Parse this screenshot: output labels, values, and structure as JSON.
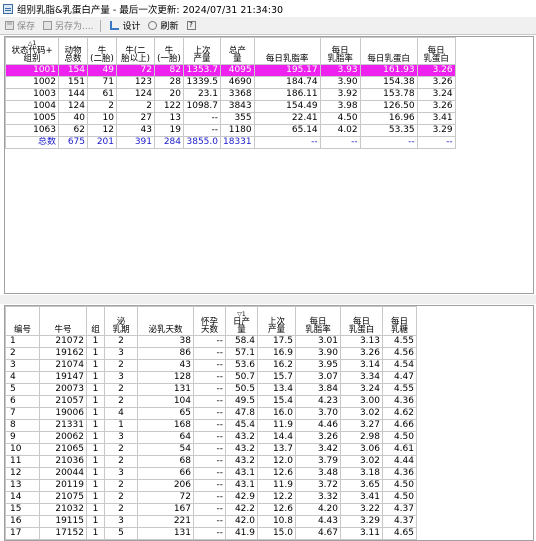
{
  "window": {
    "title": "组别乳脂&乳蛋白产量 - 最后一次更新: 2024/07/31 21:34:30"
  },
  "toolbar": {
    "save_label": "保存",
    "saveas_label": "另存为....",
    "design_label": "设计",
    "refresh_label": "刷新",
    "help_label": "?"
  },
  "top_table": {
    "headers": [
      {
        "top": "△1",
        "lines": [
          "状态代码+",
          "组别"
        ]
      },
      {
        "top": "",
        "lines": [
          "动物",
          "总数"
        ]
      },
      {
        "top": "",
        "lines": [
          "牛",
          "(二胎)"
        ]
      },
      {
        "top": "",
        "lines": [
          "牛(二",
          "胎以上)"
        ]
      },
      {
        "top": "",
        "lines": [
          "牛",
          "(一胎)"
        ]
      },
      {
        "top": "",
        "lines": [
          "上次",
          "产量"
        ]
      },
      {
        "top": "",
        "lines": [
          "总产",
          "量"
        ]
      },
      {
        "top": "",
        "lines": [
          "每日乳脂率"
        ]
      },
      {
        "top": "",
        "lines": [
          "每日",
          "乳脂率"
        ]
      },
      {
        "top": "",
        "lines": [
          "每日乳蛋白"
        ]
      },
      {
        "top": "",
        "lines": [
          "每日",
          "乳蛋白"
        ]
      }
    ],
    "rows": [
      {
        "cells": [
          "1001",
          "154",
          "49",
          "72",
          "82",
          "1353.7",
          "4095",
          "195.17",
          "3.93",
          "161.93",
          "3.26"
        ],
        "highlight": true
      },
      {
        "cells": [
          "1002",
          "151",
          "71",
          "123",
          "28",
          "1339.5",
          "4690",
          "184.74",
          "3.90",
          "154.38",
          "3.26"
        ]
      },
      {
        "cells": [
          "1003",
          "144",
          "61",
          "124",
          "20",
          "23.1",
          "3368",
          "186.11",
          "3.92",
          "153.78",
          "3.24"
        ]
      },
      {
        "cells": [
          "1004",
          "124",
          "2",
          "2",
          "122",
          "1098.7",
          "3843",
          "154.49",
          "3.98",
          "126.50",
          "3.26"
        ]
      },
      {
        "cells": [
          "1005",
          "40",
          "10",
          "27",
          "13",
          "--",
          "355",
          "22.41",
          "4.50",
          "16.96",
          "3.41"
        ]
      },
      {
        "cells": [
          "1063",
          "62",
          "12",
          "43",
          "19",
          "--",
          "1180",
          "65.14",
          "4.02",
          "53.35",
          "3.29"
        ]
      },
      {
        "cells": [
          "总数",
          "675",
          "201",
          "391",
          "284",
          "3855.0",
          "18331",
          "--",
          "--",
          "--",
          "--"
        ],
        "total": true
      }
    ]
  },
  "bottom_table": {
    "headers": [
      {
        "top": "",
        "lines": [
          "编号"
        ]
      },
      {
        "top": "",
        "lines": [
          "牛号"
        ]
      },
      {
        "top": "",
        "lines": [
          "组"
        ]
      },
      {
        "top": "",
        "lines": [
          "泌",
          "乳期"
        ]
      },
      {
        "top": "",
        "lines": [
          "泌乳天数"
        ]
      },
      {
        "top": "",
        "lines": [
          "怀孕",
          "天数"
        ]
      },
      {
        "top": "▽1",
        "lines": [
          "日产",
          "量"
        ]
      },
      {
        "top": "",
        "lines": [
          "上次",
          "产量"
        ]
      },
      {
        "top": "",
        "lines": [
          "每日",
          "乳脂率"
        ]
      },
      {
        "top": "",
        "lines": [
          "每日",
          "乳蛋白"
        ]
      },
      {
        "top": "",
        "lines": [
          "每日",
          "乳糖"
        ]
      }
    ],
    "rows": [
      [
        "1",
        "21072",
        "1",
        "2",
        "38",
        "--",
        "58.4",
        "17.5",
        "3.01",
        "3.13",
        "4.55"
      ],
      [
        "2",
        "19162",
        "1",
        "3",
        "86",
        "--",
        "57.1",
        "16.9",
        "3.90",
        "3.26",
        "4.56"
      ],
      [
        "3",
        "21074",
        "1",
        "2",
        "43",
        "--",
        "53.6",
        "16.2",
        "3.95",
        "3.14",
        "4.54"
      ],
      [
        "4",
        "19147",
        "1",
        "3",
        "128",
        "--",
        "50.7",
        "15.7",
        "3.07",
        "3.34",
        "4.47"
      ],
      [
        "5",
        "20073",
        "1",
        "2",
        "131",
        "--",
        "50.5",
        "13.4",
        "3.84",
        "3.24",
        "4.55"
      ],
      [
        "6",
        "21057",
        "1",
        "2",
        "104",
        "--",
        "49.5",
        "15.4",
        "4.23",
        "3.00",
        "4.36"
      ],
      [
        "7",
        "19006",
        "1",
        "4",
        "65",
        "--",
        "47.8",
        "16.0",
        "3.70",
        "3.02",
        "4.62"
      ],
      [
        "8",
        "21331",
        "1",
        "1",
        "168",
        "--",
        "45.4",
        "11.9",
        "4.46",
        "3.27",
        "4.66"
      ],
      [
        "9",
        "20062",
        "1",
        "3",
        "64",
        "--",
        "43.2",
        "14.4",
        "3.26",
        "2.98",
        "4.50"
      ],
      [
        "10",
        "21065",
        "1",
        "2",
        "54",
        "--",
        "43.2",
        "13.7",
        "3.42",
        "3.06",
        "4.61"
      ],
      [
        "11",
        "21036",
        "1",
        "2",
        "68",
        "--",
        "43.2",
        "12.0",
        "3.79",
        "3.02",
        "4.44"
      ],
      [
        "12",
        "20044",
        "1",
        "3",
        "66",
        "--",
        "43.1",
        "12.6",
        "3.48",
        "3.18",
        "4.36"
      ],
      [
        "13",
        "20119",
        "1",
        "2",
        "206",
        "--",
        "43.1",
        "11.9",
        "3.72",
        "3.65",
        "4.50"
      ],
      [
        "14",
        "21075",
        "1",
        "2",
        "72",
        "--",
        "42.9",
        "12.2",
        "3.32",
        "3.41",
        "4.50"
      ],
      [
        "15",
        "21032",
        "1",
        "2",
        "167",
        "--",
        "42.2",
        "12.6",
        "4.20",
        "3.22",
        "4.37"
      ],
      [
        "16",
        "19115",
        "1",
        "3",
        "221",
        "--",
        "42.0",
        "10.8",
        "4.43",
        "3.29",
        "4.37"
      ],
      [
        "17",
        "17152",
        "1",
        "5",
        "131",
        "--",
        "41.9",
        "15.0",
        "4.67",
        "3.11",
        "4.65"
      ]
    ]
  },
  "colors": {
    "highlight_row": "#ee22ee",
    "total_text": "#1a1acc"
  }
}
